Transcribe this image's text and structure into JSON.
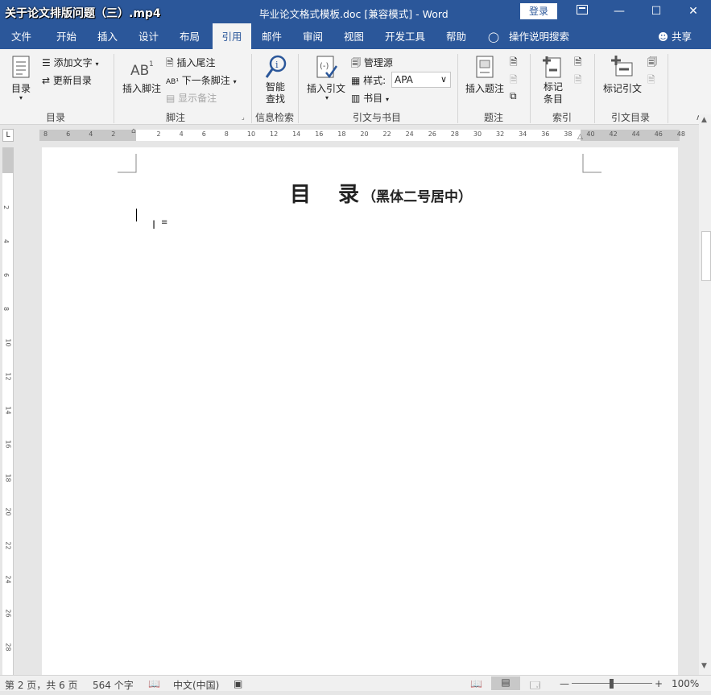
{
  "title_bar": {
    "video_overlay": "关于论文排版问题（三）.mp4",
    "document_title": "毕业论文格式模板.doc [兼容模式]  -  Word",
    "login_label": "登录"
  },
  "tabs": [
    "文件",
    "开始",
    "插入",
    "设计",
    "布局",
    "引用",
    "邮件",
    "审阅",
    "视图",
    "开发工具",
    "帮助"
  ],
  "active_tab": "引用",
  "tell_me": "操作说明搜索",
  "share_label": "共享",
  "ribbon": {
    "toc": {
      "btn": "目录",
      "add_text": "添加文字",
      "update": "更新目录",
      "label": "目录"
    },
    "footnotes": {
      "insert_footnote": "插入脚注",
      "insert_endnote": "插入尾注",
      "next_footnote": "下一条脚注",
      "show_notes": "显示备注",
      "label": "脚注"
    },
    "research": {
      "smart_lookup_line1": "智能",
      "smart_lookup_line2": "查找",
      "label": "信息检索"
    },
    "citations": {
      "insert_citation": "插入引文",
      "manage_sources": "管理源",
      "style_label": "样式:",
      "style_value": "APA",
      "bibliography": "书目",
      "label": "引文与书目"
    },
    "captions": {
      "insert_caption": "插入题注",
      "label": "题注"
    },
    "index": {
      "mark_entry_line1": "标记",
      "mark_entry_line2": "条目",
      "label": "索引"
    },
    "toa": {
      "mark_citation": "标记引文",
      "label": "引文目录"
    }
  },
  "ruler_ticks": [
    "8",
    "6",
    "4",
    "2",
    "",
    "2",
    "4",
    "6",
    "8",
    "10",
    "12",
    "14",
    "16",
    "18",
    "20",
    "22",
    "24",
    "26",
    "28",
    "30",
    "32",
    "34",
    "36",
    "38",
    "40",
    "42",
    "44",
    "46",
    "48"
  ],
  "vruler_ticks": [
    "2",
    "4",
    "6",
    "8",
    "10",
    "12",
    "14",
    "16",
    "18",
    "20",
    "22",
    "24",
    "26",
    "28"
  ],
  "document": {
    "heading_main": "目　录",
    "heading_note": "（黑体二号居中）"
  },
  "status_bar": {
    "page": "第 2 页，共 6 页",
    "words": "564 个字",
    "language": "中文(中国)",
    "zoom": "100%"
  },
  "colors": {
    "accent": "#2b579a",
    "ribbon_bg": "#f3f3f3"
  }
}
